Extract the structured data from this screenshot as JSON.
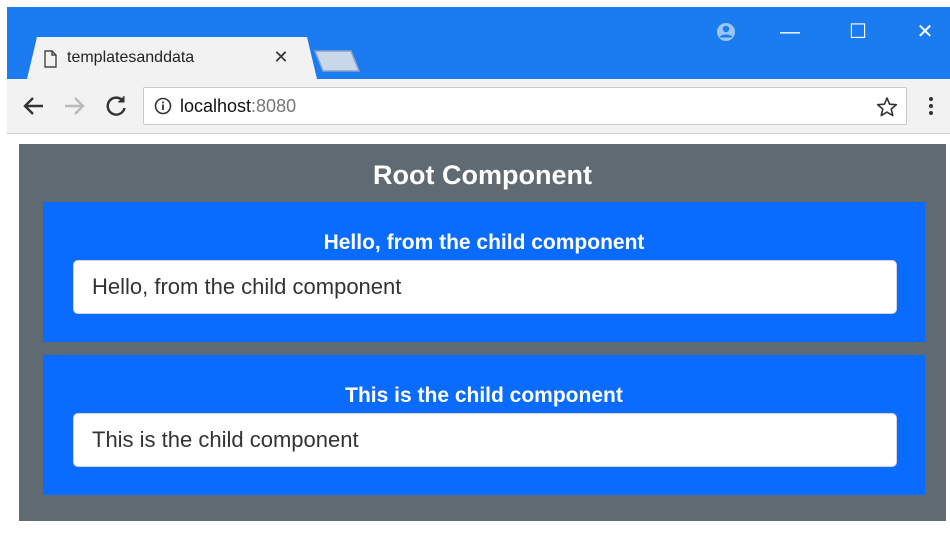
{
  "browser": {
    "tab_title": "templatesanddata",
    "tab_close": "✕",
    "url_host": "localhost",
    "url_port": ":8080",
    "controls": {
      "minimize": "—",
      "maximize": "☐",
      "close": "✕"
    },
    "icons": [
      "page-icon",
      "account-icon",
      "back-icon",
      "forward-icon",
      "reload-icon",
      "info-icon",
      "star-icon",
      "menu-icon"
    ],
    "colors": {
      "titlebar": "#1b7cf2",
      "toolbar": "#f2f2f2"
    }
  },
  "page": {
    "root_title": "Root Component",
    "children": [
      {
        "heading": "Hello, from the child component",
        "input_value": "Hello, from the child component"
      },
      {
        "heading": "This is the child component",
        "input_value": "This is the child component"
      }
    ],
    "colors": {
      "root_bg": "#5f6a72",
      "child_bg": "#0a6cff"
    }
  }
}
